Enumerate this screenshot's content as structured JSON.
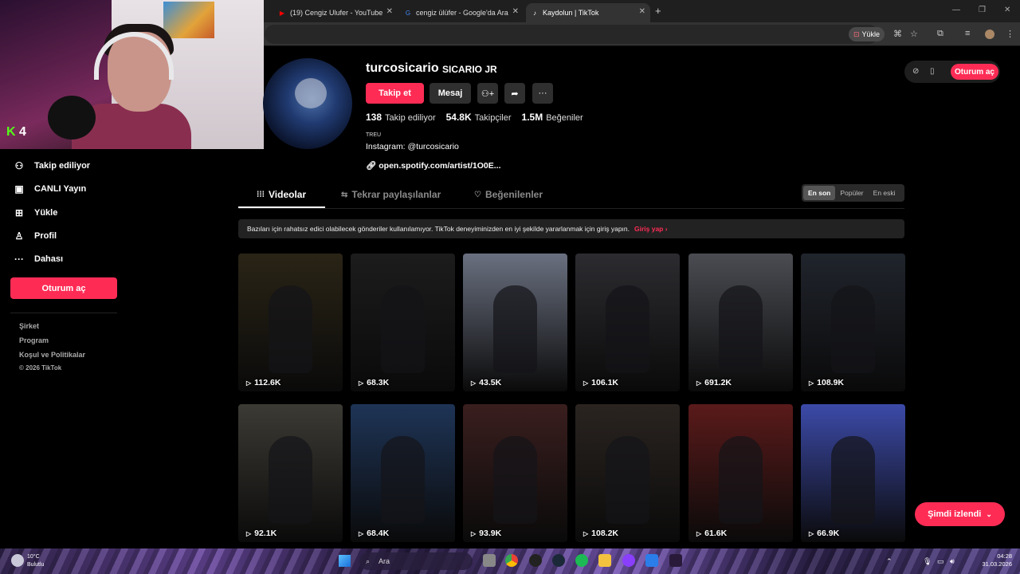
{
  "browser": {
    "tabs": [
      {
        "title": "(19) Cengiz Ulufer - YouTube",
        "icon": "youtube-icon"
      },
      {
        "title": "cengiz ülüfer - Google'da Ara",
        "icon": "google-icon"
      },
      {
        "title": "Kaydolun | TikTok",
        "icon": "tiktok-icon"
      }
    ],
    "install_label": "Yükle"
  },
  "webcam": {
    "badge_count": "4"
  },
  "sidebar": {
    "items": [
      {
        "label": "Takip ediliyor",
        "icon": "following-icon"
      },
      {
        "label": "CANLI Yayın",
        "icon": "live-icon"
      },
      {
        "label": "Yükle",
        "icon": "upload-icon"
      },
      {
        "label": "Profil",
        "icon": "profile-icon"
      },
      {
        "label": "Dahası",
        "icon": "more-icon"
      }
    ],
    "login_label": "Oturum aç",
    "footer": [
      "Şirket",
      "Program",
      "Koşul ve Politikalar",
      "© 2026 TikTok"
    ]
  },
  "profile": {
    "username": "turcosicario",
    "nickname": "SICARIO JR",
    "follow_label": "Takip et",
    "message_label": "Mesaj",
    "stats": [
      {
        "value": "138",
        "label": "Takip ediliyor"
      },
      {
        "value": "54.8K",
        "label": "Takipçiler"
      },
      {
        "value": "1.5M",
        "label": "Beğeniler"
      }
    ],
    "bio_line1": "TREU",
    "bio_line2": "Instagram: @turcosicario",
    "link": "open.spotify.com/artist/1O0E..."
  },
  "header": {
    "login_label": "Oturum aç"
  },
  "tabs": [
    {
      "label": "Videolar",
      "icon": "grid-icon"
    },
    {
      "label": "Tekrar paylaşılanlar",
      "icon": "repost-icon"
    },
    {
      "label": "Beğenilenler",
      "icon": "heart-icon"
    }
  ],
  "sort": [
    "En son",
    "Popüler",
    "En eski"
  ],
  "banner": {
    "text": "Bazıları için rahatsız edici olabilecek gönderiler kullanılamıyor. TikTok deneyiminizden en iyi şekilde yararlanmak için giriş yapın.",
    "action": "Giriş yap"
  },
  "videos": [
    {
      "views": "112.6K",
      "color": "#2a2416"
    },
    {
      "views": "68.3K",
      "color": "#1c1c1c"
    },
    {
      "views": "43.5K",
      "color": "#6a7080"
    },
    {
      "views": "106.1K",
      "color": "#2c2c30"
    },
    {
      "views": "691.2K",
      "color": "#4a4c52"
    },
    {
      "views": "108.9K",
      "color": "#20242c"
    },
    {
      "views": "92.1K",
      "color": "#3c3a34"
    },
    {
      "views": "68.4K",
      "color": "#1e3456"
    },
    {
      "views": "93.9K",
      "color": "#3a1e1e"
    },
    {
      "views": "108.2K",
      "color": "#2a2420"
    },
    {
      "views": "61.6K",
      "color": "#5a1a1a"
    },
    {
      "views": "66.9K",
      "color": "#3c4aa8"
    }
  ],
  "floating_button": "Şimdi izlendi",
  "taskbar": {
    "temperature": "10°C",
    "weather": "Bulutlu",
    "search_placeholder": "Ara",
    "time": "04:28",
    "date": "31.03.2026"
  }
}
